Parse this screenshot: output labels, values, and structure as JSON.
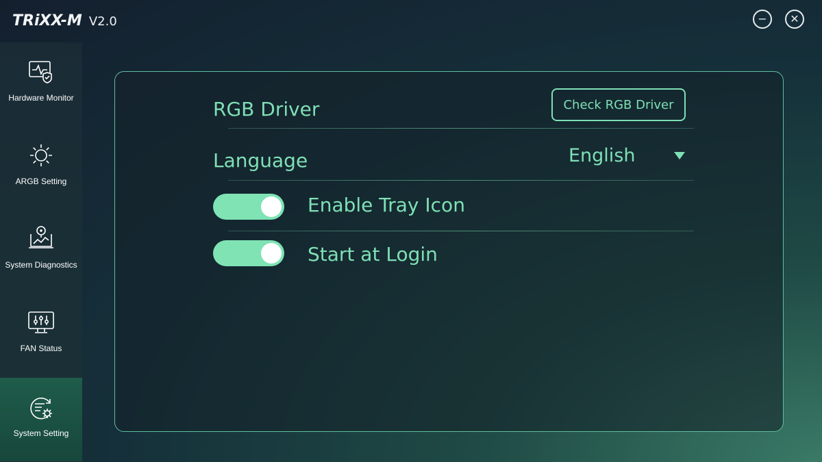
{
  "app": {
    "brand": "TRiXX-M",
    "version": "V2.0"
  },
  "window_controls": {
    "minimize_icon": "minus-circle-icon",
    "close_icon": "close-circle-icon"
  },
  "sidebar": {
    "items": [
      {
        "label": "Hardware Monitor",
        "icon": "hardware-monitor-icon",
        "active": false
      },
      {
        "label": "ARGB Setting",
        "icon": "sun-icon",
        "active": false
      },
      {
        "label": "System Diagnostics",
        "icon": "diagnostics-icon",
        "active": false
      },
      {
        "label": "FAN Status",
        "icon": "fan-status-icon",
        "active": false
      },
      {
        "label": "System Setting",
        "icon": "settings-gear-icon",
        "active": true
      }
    ]
  },
  "settings": {
    "rgb_driver_label": "RGB Driver",
    "check_rgb_button": "Check RGB Driver",
    "language_label": "Language",
    "language_value": "English",
    "tray_icon_label": "Enable Tray Icon",
    "tray_icon_enabled": true,
    "start_login_label": "Start at Login",
    "start_login_enabled": true
  },
  "colors": {
    "accent": "#7fe0b5",
    "toggle_on": "#7fe3b4",
    "active_nav": "#1f5c4a"
  }
}
